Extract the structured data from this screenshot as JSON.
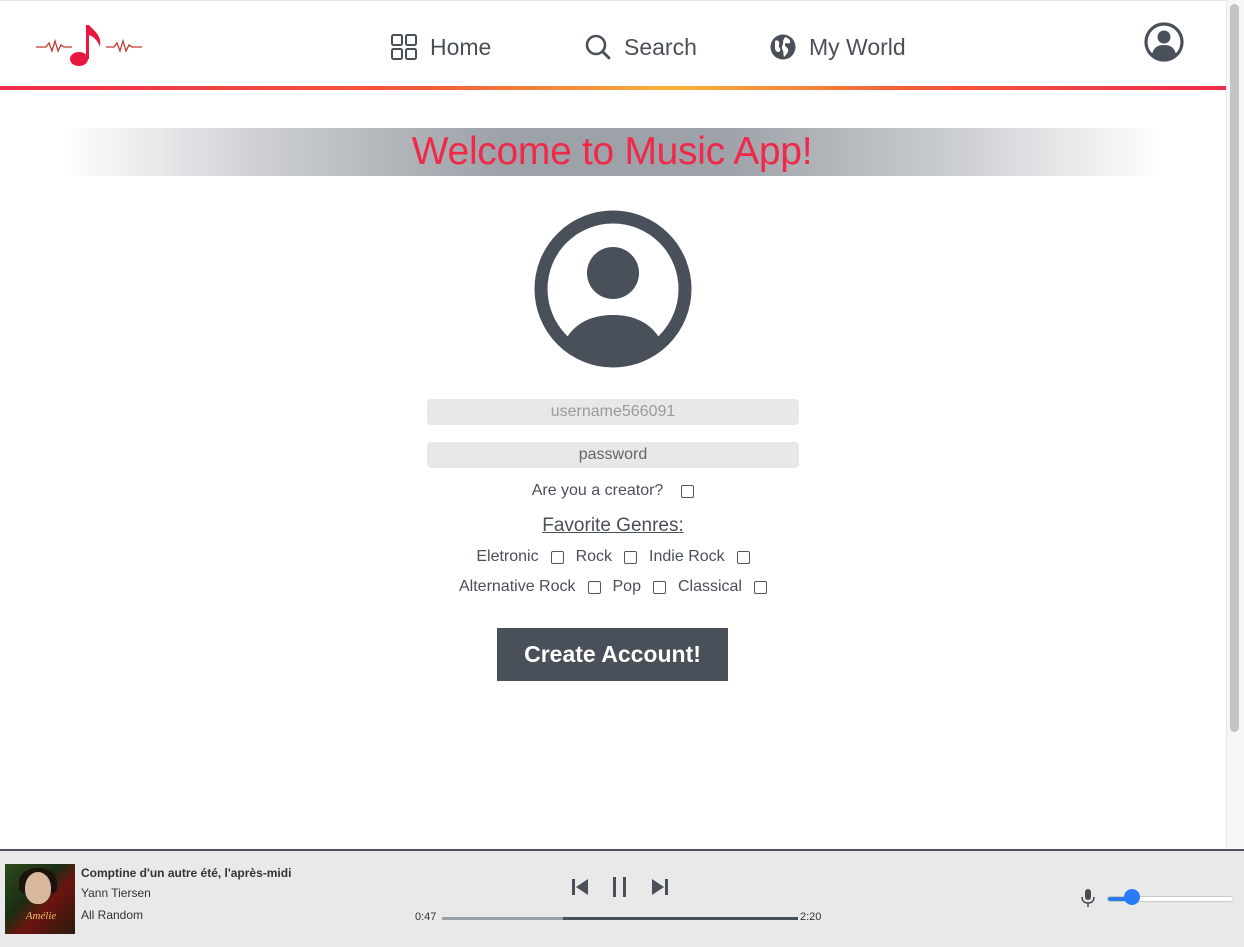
{
  "nav": {
    "home_label": "Home",
    "search_label": "Search",
    "world_label": "My World"
  },
  "welcome": {
    "title": "Welcome to Music App!"
  },
  "form": {
    "username_placeholder": "username566091",
    "password_placeholder": "password",
    "creator_label": "Are you a creator?",
    "genres_title": "Favorite Genres:",
    "genres_row1": [
      "Eletronic",
      "Rock",
      "Indie Rock"
    ],
    "genres_row2": [
      "Alternative Rock",
      "Pop",
      "Classical"
    ],
    "submit_label": "Create Account!"
  },
  "player": {
    "cover_text": "Amélie",
    "track_title": "Comptine d'un autre été, l'après-midi",
    "artist": "Yann Tiersen",
    "album": "All Random",
    "current_time": "0:47",
    "total_time": "2:20",
    "progress": 0.34,
    "volume": 0.2
  },
  "colors": {
    "accent": "#f0284a",
    "dark": "#4a5059",
    "volume": "#2a7bf6"
  },
  "icons": {
    "logo": "music-note-logo",
    "home": "grid-icon",
    "search": "search-icon",
    "world": "globe-icon",
    "profile": "user-circle-icon",
    "prev": "skip-back-icon",
    "pause": "pause-icon",
    "next": "skip-forward-icon",
    "mic": "mic-icon"
  }
}
